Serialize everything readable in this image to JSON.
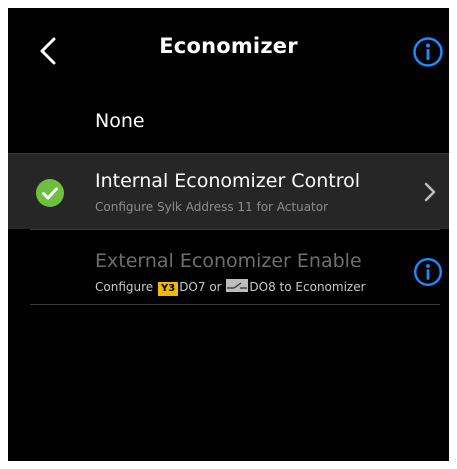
{
  "header": {
    "title": "Economizer",
    "back_icon": "chevron-left-icon",
    "info_icon": "info-icon"
  },
  "options": {
    "none": {
      "label": "None"
    },
    "internal": {
      "label": "Internal Economizer Control",
      "sublabel": "Configure Sylk Address 11 for Actuator",
      "selected": true,
      "status_icon": "check-circle-icon"
    },
    "external": {
      "label": "External Economizer Enable",
      "sublabel_prefix": "Configure ",
      "badge_y3": "Y3",
      "sublabel_middle": "DO7 or ",
      "sublabel_suffix": "DO8 to Economizer",
      "enabled": false
    }
  },
  "colors": {
    "accent_blue": "#1a8cff",
    "selected_green": "#6fbf3f",
    "badge_yellow": "#f5b800",
    "background": "#000000",
    "selected_row": "#262626"
  }
}
